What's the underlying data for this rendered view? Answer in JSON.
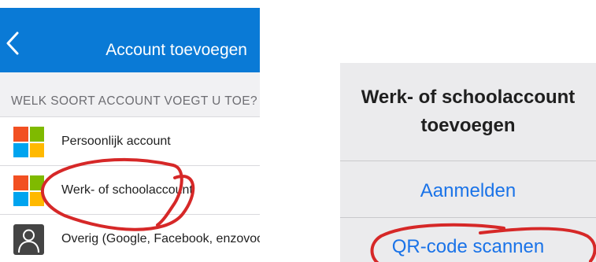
{
  "left": {
    "navbar": {
      "title": "Account toevoegen",
      "back_icon": "chevron-left-icon",
      "color": "#0a7ad6"
    },
    "section_header": "WELK SOORT ACCOUNT VOEGT U TOE?",
    "items": [
      {
        "label": "Persoonlijk account",
        "icon": "microsoft-logo-icon"
      },
      {
        "label": "Werk- of schoolaccount",
        "icon": "microsoft-logo-icon"
      },
      {
        "label": "Overig (Google, Facebook, enzovoort)",
        "icon": "person-icon"
      }
    ]
  },
  "right": {
    "title_line1": "Werk- of schoolaccount",
    "title_line2": "toevoegen",
    "actions": [
      {
        "label": "Aanmelden"
      },
      {
        "label": "QR-code scannen"
      }
    ],
    "action_color": "#1a73e8"
  },
  "annotation_color": "#d62828"
}
